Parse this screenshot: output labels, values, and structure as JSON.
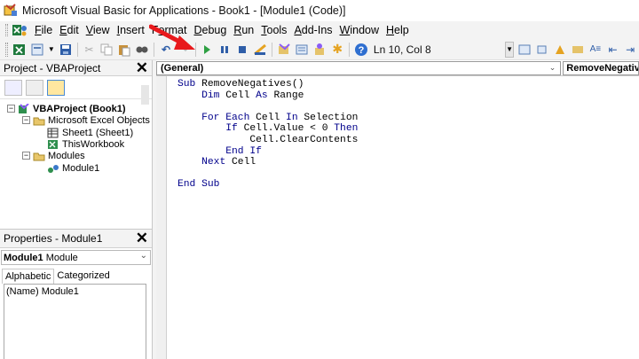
{
  "window": {
    "title": "Microsoft Visual Basic for Applications - Book1 - [Module1 (Code)]"
  },
  "menu": {
    "items": [
      {
        "label": "File",
        "accel": "F",
        "rest": "ile"
      },
      {
        "label": "Edit",
        "accel": "E",
        "rest": "dit"
      },
      {
        "label": "View",
        "accel": "V",
        "rest": "iew"
      },
      {
        "label": "Insert",
        "accel": "I",
        "rest": "nsert"
      },
      {
        "label": "Format",
        "accel": "o",
        "pre": "F",
        "rest": "rmat"
      },
      {
        "label": "Debug",
        "accel": "D",
        "rest": "ebug"
      },
      {
        "label": "Run",
        "accel": "R",
        "rest": "un"
      },
      {
        "label": "Tools",
        "accel": "T",
        "rest": "ools"
      },
      {
        "label": "Add-Ins",
        "accel": "A",
        "rest": "dd-Ins"
      },
      {
        "label": "Window",
        "accel": "W",
        "rest": "indow"
      },
      {
        "label": "Help",
        "accel": "H",
        "rest": "elp"
      }
    ]
  },
  "toolbar": {
    "cursor_position": "Ln 10, Col 8",
    "icons": [
      "view-excel-icon",
      "insert-module-icon",
      "save-icon",
      "cut-icon",
      "copy-icon",
      "paste-icon",
      "find-icon",
      "undo-icon",
      "redo-icon",
      "run-icon",
      "break-icon",
      "reset-icon",
      "design-mode-icon",
      "project-explorer-icon",
      "properties-window-icon",
      "object-browser-icon",
      "toolbox-icon",
      "help-icon"
    ]
  },
  "project_pane": {
    "title": "Project - VBAProject",
    "tree": {
      "project": "VBAProject (Book1)",
      "objects_folder": "Microsoft Excel Objects",
      "sheet1": "Sheet1 (Sheet1)",
      "workbook": "ThisWorkbook",
      "modules_folder": "Modules",
      "module1": "Module1"
    }
  },
  "properties_pane": {
    "title": "Properties - Module1",
    "selected_object_name": "Module1",
    "selected_object_type": "Module",
    "tabs": [
      "Alphabetic",
      "Categorized"
    ],
    "row": "(Name) Module1"
  },
  "code_window": {
    "object_combo": "(General)",
    "procedure_combo": "RemoveNegatives",
    "lines": [
      {
        "indent": "",
        "parts": [
          {
            "t": "Sub ",
            "k": true
          },
          {
            "t": "RemoveNegatives()",
            "k": false
          }
        ]
      },
      {
        "indent": "    ",
        "parts": [
          {
            "t": "Dim ",
            "k": true
          },
          {
            "t": "Cell ",
            "k": false
          },
          {
            "t": "As ",
            "k": true
          },
          {
            "t": "Range",
            "k": false
          }
        ]
      },
      {
        "indent": "",
        "parts": []
      },
      {
        "indent": "    ",
        "parts": [
          {
            "t": "For Each ",
            "k": true
          },
          {
            "t": "Cell ",
            "k": false
          },
          {
            "t": "In ",
            "k": true
          },
          {
            "t": "Selection",
            "k": false
          }
        ]
      },
      {
        "indent": "        ",
        "parts": [
          {
            "t": "If ",
            "k": true
          },
          {
            "t": "Cell.Value < 0 ",
            "k": false
          },
          {
            "t": "Then",
            "k": true
          }
        ]
      },
      {
        "indent": "            ",
        "parts": [
          {
            "t": "Cell.ClearContents",
            "k": false
          }
        ]
      },
      {
        "indent": "        ",
        "parts": [
          {
            "t": "End If",
            "k": true
          }
        ]
      },
      {
        "indent": "    ",
        "parts": [
          {
            "t": "Next ",
            "k": true
          },
          {
            "t": "Cell",
            "k": false
          }
        ]
      },
      {
        "indent": "",
        "parts": []
      },
      {
        "indent": "",
        "parts": [
          {
            "t": "End Sub",
            "k": true
          }
        ]
      }
    ]
  },
  "colors": {
    "keyword": "#00008b",
    "annotation_arrow": "#e8191c"
  }
}
